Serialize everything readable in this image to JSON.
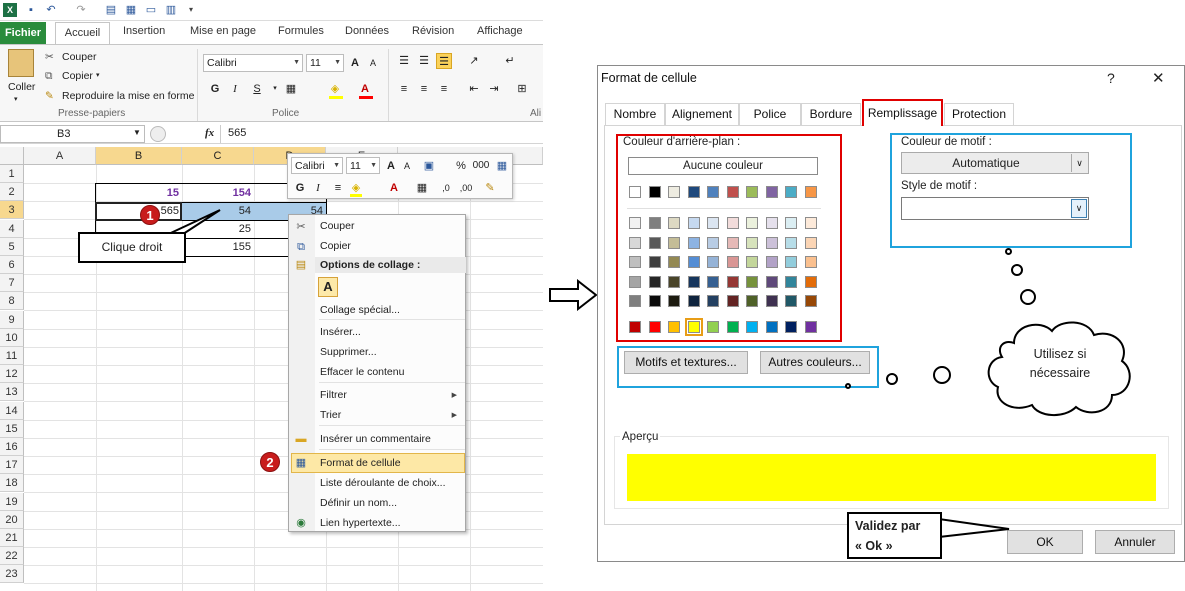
{
  "excel": {
    "ribbon_tabs": [
      "Fichier",
      "Accueil",
      "Insertion",
      "Mise en page",
      "Formules",
      "Données",
      "Révision",
      "Affichage"
    ],
    "clipboard": {
      "paste": "Coller",
      "cut": "Couper",
      "copy": "Copier",
      "painter": "Reproduire la mise en forme",
      "group": "Presse-papiers"
    },
    "font_group": {
      "font": "Calibri",
      "size": "11",
      "bold": "G",
      "italic": "I",
      "underline": "S",
      "group": "Police"
    },
    "align_group": {
      "group": "Ali"
    },
    "name_box": "B3",
    "fx": "fx",
    "formula_value": "565",
    "columns": [
      "A",
      "B",
      "C",
      "D",
      "E"
    ],
    "rows": [
      "1",
      "2",
      "3",
      "4",
      "5",
      "6",
      "7",
      "8",
      "9",
      "10",
      "11",
      "12",
      "13",
      "14",
      "15",
      "16",
      "17",
      "18",
      "19",
      "20",
      "21",
      "22",
      "23"
    ],
    "cells": {
      "b2": "15",
      "c2": "154",
      "b3": "565",
      "c3": "54",
      "d3": "54",
      "d4": "25",
      "c5": "155"
    },
    "mini_toolbar": {
      "font": "Calibri",
      "size": "11",
      "percent": "%",
      "thousands": "000",
      "bold": "G",
      "italic": "I"
    },
    "context_menu": {
      "cut": "Couper",
      "copy": "Copier",
      "paste_options": "Options de collage :",
      "paste_a": "A",
      "paste_special": "Collage spécial...",
      "insert": "Insérer...",
      "delete": "Supprimer...",
      "clear": "Effacer le contenu",
      "filter": "Filtrer",
      "sort": "Trier",
      "comment": "Insérer un commentaire",
      "format": "Format de cellule",
      "dropdown": "Liste déroulante de choix...",
      "define_name": "Définir un nom...",
      "hyperlink": "Lien hypertexte..."
    },
    "callout1": {
      "num": "1",
      "text": "Clique droit"
    },
    "callout2": {
      "num": "2"
    }
  },
  "dialog": {
    "title": "Format de cellule",
    "help": "?",
    "close": "✕",
    "tabs": [
      "Nombre",
      "Alignement",
      "Police",
      "Bordure",
      "Remplissage",
      "Protection"
    ],
    "bg_label": "Couleur d'arrière-plan :",
    "no_color": "Aucune couleur",
    "pattern_color_label": "Couleur de motif :",
    "pattern_color_value": "Automatique",
    "pattern_style_label": "Style de motif :",
    "fill_effects": "Motifs et textures...",
    "more_colors": "Autres couleurs...",
    "preview_label": "Aperçu",
    "preview_color": "#ffff00",
    "ok": "OK",
    "cancel": "Annuler",
    "theme_row": [
      "#ffffff",
      "#000000",
      "#eeece1",
      "#1f497d",
      "#4f81bd",
      "#c0504d",
      "#9bbb59",
      "#8064a2",
      "#4bacc6",
      "#f79646"
    ],
    "tint_rows": [
      [
        "#f2f2f2",
        "#7f7f7f",
        "#ddd9c3",
        "#c6d9f0",
        "#dbe5f1",
        "#f2dcdb",
        "#ebf1dd",
        "#e5e0ec",
        "#dbeef3",
        "#fdeada"
      ],
      [
        "#d8d8d8",
        "#595959",
        "#c4bd97",
        "#8db3e2",
        "#b8cce4",
        "#e5b9b7",
        "#d7e3bc",
        "#ccc1d9",
        "#b7dde8",
        "#fbd5b5"
      ],
      [
        "#bfbfbf",
        "#3f3f3f",
        "#938953",
        "#548dd4",
        "#95b3d7",
        "#d99694",
        "#c3d69b",
        "#b2a2c7",
        "#92cddc",
        "#fac08f"
      ],
      [
        "#a5a5a5",
        "#262626",
        "#494429",
        "#17365d",
        "#366092",
        "#953734",
        "#76923c",
        "#5f497a",
        "#31859b",
        "#e36c09"
      ],
      [
        "#7f7f7f",
        "#0c0c0c",
        "#1d1b10",
        "#0f243e",
        "#244061",
        "#632423",
        "#4f6128",
        "#3f3151",
        "#205867",
        "#974806"
      ]
    ],
    "standard_row": [
      "#c00000",
      "#ff0000",
      "#ffc000",
      "#ffff00",
      "#92d050",
      "#00b050",
      "#00b0f0",
      "#0070c0",
      "#002060",
      "#7030a0"
    ]
  },
  "annotations": {
    "thought": "Utilisez si nécessaire",
    "validate": "Validez par « Ok »"
  }
}
